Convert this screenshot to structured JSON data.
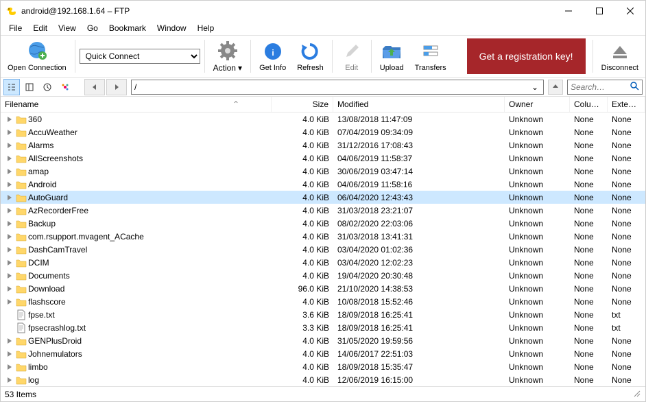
{
  "window": {
    "title": "android@192.168.1.64 – FTP"
  },
  "menu": [
    "File",
    "Edit",
    "View",
    "Go",
    "Bookmark",
    "Window",
    "Help"
  ],
  "toolbar": {
    "open_connection": "Open Connection",
    "quick_connect": "Quick Connect",
    "action": "Action",
    "get_info": "Get Info",
    "refresh": "Refresh",
    "edit": "Edit",
    "upload": "Upload",
    "transfers": "Transfers",
    "reg_key": "Get a registration key!",
    "disconnect": "Disconnect"
  },
  "nav": {
    "path": "/",
    "search_placeholder": "Search…"
  },
  "columns": {
    "name": "Filename",
    "size": "Size",
    "mod": "Modified",
    "owner": "Owner",
    "col": "Colum...",
    "ext": "Extensi..."
  },
  "files": [
    {
      "t": "d",
      "name": "360",
      "size": "4.0 KiB",
      "mod": "13/08/2018 11:47:09",
      "owner": "Unknown",
      "col": "None",
      "ext": "None"
    },
    {
      "t": "d",
      "name": "AccuWeather",
      "size": "4.0 KiB",
      "mod": "07/04/2019 09:34:09",
      "owner": "Unknown",
      "col": "None",
      "ext": "None"
    },
    {
      "t": "d",
      "name": "Alarms",
      "size": "4.0 KiB",
      "mod": "31/12/2016 17:08:43",
      "owner": "Unknown",
      "col": "None",
      "ext": "None"
    },
    {
      "t": "d",
      "name": "AllScreenshots",
      "size": "4.0 KiB",
      "mod": "04/06/2019 11:58:37",
      "owner": "Unknown",
      "col": "None",
      "ext": "None"
    },
    {
      "t": "d",
      "name": "amap",
      "size": "4.0 KiB",
      "mod": "30/06/2019 03:47:14",
      "owner": "Unknown",
      "col": "None",
      "ext": "None"
    },
    {
      "t": "d",
      "name": "Android",
      "size": "4.0 KiB",
      "mod": "04/06/2019 11:58:16",
      "owner": "Unknown",
      "col": "None",
      "ext": "None"
    },
    {
      "t": "d",
      "name": "AutoGuard",
      "size": "4.0 KiB",
      "mod": "06/04/2020 12:43:43",
      "owner": "Unknown",
      "col": "None",
      "ext": "None",
      "sel": true
    },
    {
      "t": "d",
      "name": "AzRecorderFree",
      "size": "4.0 KiB",
      "mod": "31/03/2018 23:21:07",
      "owner": "Unknown",
      "col": "None",
      "ext": "None"
    },
    {
      "t": "d",
      "name": "Backup",
      "size": "4.0 KiB",
      "mod": "08/02/2020 22:03:06",
      "owner": "Unknown",
      "col": "None",
      "ext": "None"
    },
    {
      "t": "d",
      "name": "com.rsupport.mvagent_ACache",
      "size": "4.0 KiB",
      "mod": "31/03/2018 13:41:31",
      "owner": "Unknown",
      "col": "None",
      "ext": "None"
    },
    {
      "t": "d",
      "name": "DashCamTravel",
      "size": "4.0 KiB",
      "mod": "03/04/2020 01:02:36",
      "owner": "Unknown",
      "col": "None",
      "ext": "None"
    },
    {
      "t": "d",
      "name": "DCIM",
      "size": "4.0 KiB",
      "mod": "03/04/2020 12:02:23",
      "owner": "Unknown",
      "col": "None",
      "ext": "None"
    },
    {
      "t": "d",
      "name": "Documents",
      "size": "4.0 KiB",
      "mod": "19/04/2020 20:30:48",
      "owner": "Unknown",
      "col": "None",
      "ext": "None"
    },
    {
      "t": "d",
      "name": "Download",
      "size": "96.0 KiB",
      "mod": "21/10/2020 14:38:53",
      "owner": "Unknown",
      "col": "None",
      "ext": "None"
    },
    {
      "t": "d",
      "name": "flashscore",
      "size": "4.0 KiB",
      "mod": "10/08/2018 15:52:46",
      "owner": "Unknown",
      "col": "None",
      "ext": "None"
    },
    {
      "t": "f",
      "name": "fpse.txt",
      "size": "3.6 KiB",
      "mod": "18/09/2018 16:25:41",
      "owner": "Unknown",
      "col": "None",
      "ext": "txt"
    },
    {
      "t": "f",
      "name": "fpsecrashlog.txt",
      "size": "3.3 KiB",
      "mod": "18/09/2018 16:25:41",
      "owner": "Unknown",
      "col": "None",
      "ext": "txt"
    },
    {
      "t": "d",
      "name": "GENPlusDroid",
      "size": "4.0 KiB",
      "mod": "31/05/2020 19:59:56",
      "owner": "Unknown",
      "col": "None",
      "ext": "None"
    },
    {
      "t": "d",
      "name": "Johnemulators",
      "size": "4.0 KiB",
      "mod": "14/06/2017 22:51:03",
      "owner": "Unknown",
      "col": "None",
      "ext": "None"
    },
    {
      "t": "d",
      "name": "limbo",
      "size": "4.0 KiB",
      "mod": "18/09/2018 15:35:47",
      "owner": "Unknown",
      "col": "None",
      "ext": "None"
    },
    {
      "t": "d",
      "name": "log",
      "size": "4.0 KiB",
      "mod": "12/06/2019 16:15:00",
      "owner": "Unknown",
      "col": "None",
      "ext": "None"
    }
  ],
  "status": {
    "count": "53 Items"
  }
}
